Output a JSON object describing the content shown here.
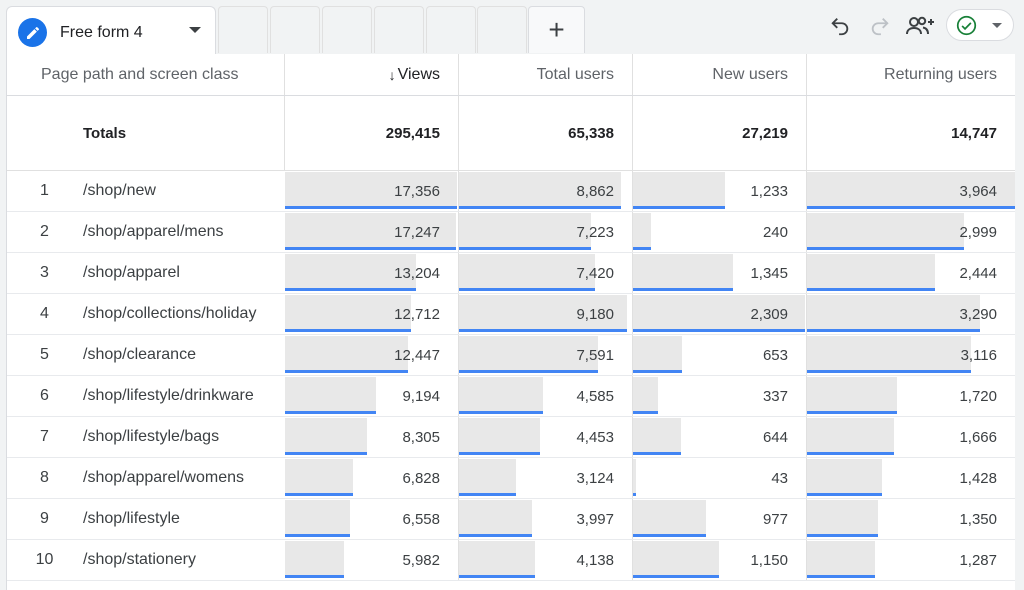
{
  "tabs": {
    "active_label": "Free form 4",
    "add_label": "+"
  },
  "toolbar": {
    "icons": [
      "undo-icon",
      "redo-icon",
      "share-user-icon",
      "check-circle-icon",
      "chevron-down-icon"
    ],
    "accent_color": "#1a73e8",
    "bar_color": "#4285f4",
    "success_color": "#188038"
  },
  "table": {
    "dimension_header": "Page path and screen class",
    "sort_indicator": "↓",
    "columns": [
      {
        "key": "views",
        "label": "Views",
        "sorted": true
      },
      {
        "key": "total_users",
        "label": "Total users",
        "sorted": false
      },
      {
        "key": "new_users",
        "label": "New users",
        "sorted": false
      },
      {
        "key": "returning_users",
        "label": "Returning users",
        "sorted": false
      }
    ],
    "totals": {
      "label": "Totals",
      "values": [
        "295,415",
        "65,338",
        "27,219",
        "14,747"
      ]
    },
    "rows": [
      {
        "rank": "1",
        "path": "/shop/new",
        "values": [
          "17,356",
          "8,862",
          "1,233",
          "3,964"
        ],
        "raw": [
          17356,
          8862,
          1233,
          3964
        ]
      },
      {
        "rank": "2",
        "path": "/shop/apparel/mens",
        "values": [
          "17,247",
          "7,223",
          "240",
          "2,999"
        ],
        "raw": [
          17247,
          7223,
          240,
          2999
        ]
      },
      {
        "rank": "3",
        "path": "/shop/apparel",
        "values": [
          "13,204",
          "7,420",
          "1,345",
          "2,444"
        ],
        "raw": [
          13204,
          7420,
          1345,
          2444
        ]
      },
      {
        "rank": "4",
        "path": "/shop/collections/holiday",
        "values": [
          "12,712",
          "9,180",
          "2,309",
          "3,290"
        ],
        "raw": [
          12712,
          9180,
          2309,
          3290
        ]
      },
      {
        "rank": "5",
        "path": "/shop/clearance",
        "values": [
          "12,447",
          "7,591",
          "653",
          "3,116"
        ],
        "raw": [
          12447,
          7591,
          653,
          3116
        ]
      },
      {
        "rank": "6",
        "path": "/shop/lifestyle/drinkware",
        "values": [
          "9,194",
          "4,585",
          "337",
          "1,720"
        ],
        "raw": [
          9194,
          4585,
          337,
          1720
        ]
      },
      {
        "rank": "7",
        "path": "/shop/lifestyle/bags",
        "values": [
          "8,305",
          "4,453",
          "644",
          "1,666"
        ],
        "raw": [
          8305,
          4453,
          644,
          1666
        ]
      },
      {
        "rank": "8",
        "path": "/shop/apparel/womens",
        "values": [
          "6,828",
          "3,124",
          "43",
          "1,428"
        ],
        "raw": [
          6828,
          3124,
          43,
          1428
        ]
      },
      {
        "rank": "9",
        "path": "/shop/lifestyle",
        "values": [
          "6,558",
          "3,997",
          "977",
          "1,350"
        ],
        "raw": [
          6558,
          3997,
          977,
          1350
        ]
      },
      {
        "rank": "10",
        "path": "/shop/stationery",
        "values": [
          "5,982",
          "4,138",
          "1,150",
          "1,287"
        ],
        "raw": [
          5982,
          4138,
          1150,
          1287
        ]
      }
    ]
  }
}
